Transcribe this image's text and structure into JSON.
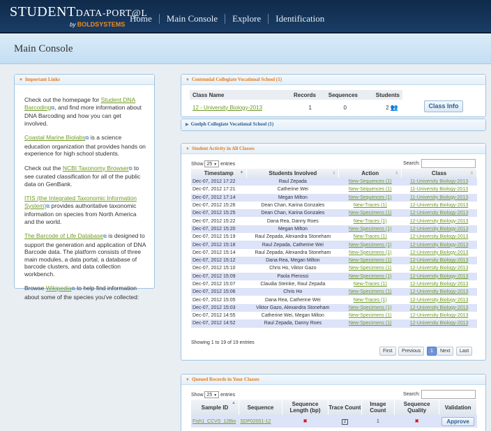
{
  "header": {
    "logo_main": "STUDENT",
    "logo_sub": "DATA-PORT@L",
    "logo_by": "by",
    "logo_brand": "BOLDSYSTEMS",
    "nav": [
      "Home",
      "Main Console",
      "Explore",
      "Identification"
    ]
  },
  "page_title": "Main Console",
  "important_links": {
    "title": "Important Links",
    "p1_pre": "Check out the homepage for ",
    "p1_link": "Student DNA Barcoding",
    "p1_post": ", and find more information about DNA Barcoding and how you can get involved.",
    "p2_link": "Coastal Marine Biolabs",
    "p2_post": " is a science education organization that provides hands on experience for high school students.",
    "p3_pre": "Check out the ",
    "p3_link": "NCBI Taxonomy Browser",
    "p3_post": " to see curated classification for all of the public data on GenBank.",
    "p4_link": "ITIS (the Integrated Taxonomic Information System)",
    "p4_post": " provides authoritative taxonomic information on species from North America and the world.",
    "p5_link": "The Barcode of Life Database",
    "p5_post": " is designed to support the generation and application of DNA Barcode data. The platform consists of three main modules, a data portal, a database of barcode clusters, and data collection workbench.",
    "p6_pre": "Browse ",
    "p6_link": "Wikipedia",
    "p6_post": " to help find information about some of the species you've collected:"
  },
  "centennial": {
    "title": "Centennial Collegiate Vocational School (1)",
    "headers": [
      "Class Name",
      "Records",
      "Sequences",
      "Students"
    ],
    "row": {
      "class": "12 - University Biology-2013",
      "records": "1",
      "sequences": "0",
      "students": "2"
    },
    "class_info_button": "Class Info"
  },
  "guelph": {
    "title": "Guelph Collegiate Vocational School (1)"
  },
  "activity": {
    "title": "Student Activity in All Classes",
    "show": "Show",
    "entries_value": "25",
    "entries": "entries",
    "search_label": "Search:",
    "headers": [
      "Timestamp",
      "Students Involved",
      "Action",
      "Class"
    ],
    "rows": [
      [
        "Dec-07, 2012 17:22",
        "Raul Zepada",
        "New-Sequences (1)",
        "11-University Biology-2013"
      ],
      [
        "Dec-07, 2012 17:21",
        "Catherine Wei",
        "New-Sequences (1)",
        "11-University Biology-2013"
      ],
      [
        "Dec-07, 2012 17:14",
        "Megan Milton",
        "New-Sequences (1)",
        "11-University Biology-2013"
      ],
      [
        "Dec-07, 2012 15:26",
        "Dean Chan, Karina Gonzales",
        "New-Traces (1)",
        "12-University Biology-2013"
      ],
      [
        "Dec-07, 2012 15:25",
        "Dean Chan, Karina Gonzales",
        "New-Specimens (1)",
        "12-University Biology-2013"
      ],
      [
        "Dec-07, 2012 15:22",
        "Dana Rea, Danny Roes",
        "New-Traces (1)",
        "12-University Biology-2013"
      ],
      [
        "Dec-07, 2012 15:20",
        "Megan Milton",
        "New-Specimens (1)",
        "12-University Biology-2013"
      ],
      [
        "Dec-07, 2012 15:19",
        "Raul Zepada, Alexandra Stoneham",
        "New-Traces (1)",
        "12-University Biology-2013"
      ],
      [
        "Dec-07, 2012 15:18",
        "Raul Zepada, Catherine Wei",
        "New-Specimens (1)",
        "12-University Biology-2013"
      ],
      [
        "Dec-07, 2012 15:14",
        "Raul Zepada, Alexandra Stoneham",
        "New-Specimens (1)",
        "12-University Biology-2013"
      ],
      [
        "Dec-07, 2012 15:12",
        "Dana Rea, Megan Milton",
        "New-Specimens (1)",
        "12-University Biology-2013"
      ],
      [
        "Dec-07, 2012 15:10",
        "Chris Ho, Viktor Gazo",
        "New-Specimens (1)",
        "12-University Biology-2013"
      ],
      [
        "Dec-07, 2012 15:09",
        "Paola Pierossi",
        "New-Specimens (1)",
        "12-University Biology-2013"
      ],
      [
        "Dec-07, 2012 15:07",
        "Claudia Steinke, Raul Zepada",
        "New-Traces (1)",
        "12-University Biology-2013"
      ],
      [
        "Dec-07, 2012 15:06",
        "Chris Ho",
        "New-Specimens (1)",
        "12-University Biology-2013"
      ],
      [
        "Dec-07, 2012 15:05",
        "Dana Rea, Catherine Wei",
        "New-Traces (1)",
        "12-University Biology-2013"
      ],
      [
        "Dec-07, 2012 15:03",
        "Viktor Gazo, Alexandra Stoneham",
        "New-Specimens (1)",
        "12-University Biology-2013"
      ],
      [
        "Dec-07, 2012 14:55",
        "Catherine Wei, Megan Milton",
        "New-Specimens (1)",
        "12-University Biology-2013"
      ],
      [
        "Dec-07, 2012 14:52",
        "Raul Zepada, Danny Roes",
        "New-Specimens (1)",
        "12-University Biology-2013"
      ]
    ],
    "info": "Showing 1 to 19 of 19 entries",
    "pagination": {
      "first": "First",
      "previous": "Previous",
      "page": "1",
      "next": "Next",
      "last": "Last"
    }
  },
  "queued": {
    "title": "Queued Records in Your Classes",
    "show": "Show",
    "entries_value": "25",
    "entries": "entries",
    "search_label": "Search:",
    "headers": [
      "Sample ID",
      "Sequence",
      "Sequence Length (bp)",
      "Trace Count",
      "Image Count",
      "Sequence Quality",
      "Validation"
    ],
    "row": {
      "sample_id": "Fish1_CCVS_12Bio",
      "sequence": "SDP02001-12",
      "length": "✖",
      "trace": "2",
      "image": "1",
      "quality": "✖"
    },
    "approve_button": "Approve"
  },
  "colors": {
    "accent_orange": "#e47a1a",
    "link_green": "#6e9a24",
    "error_red": "#cc1111"
  }
}
